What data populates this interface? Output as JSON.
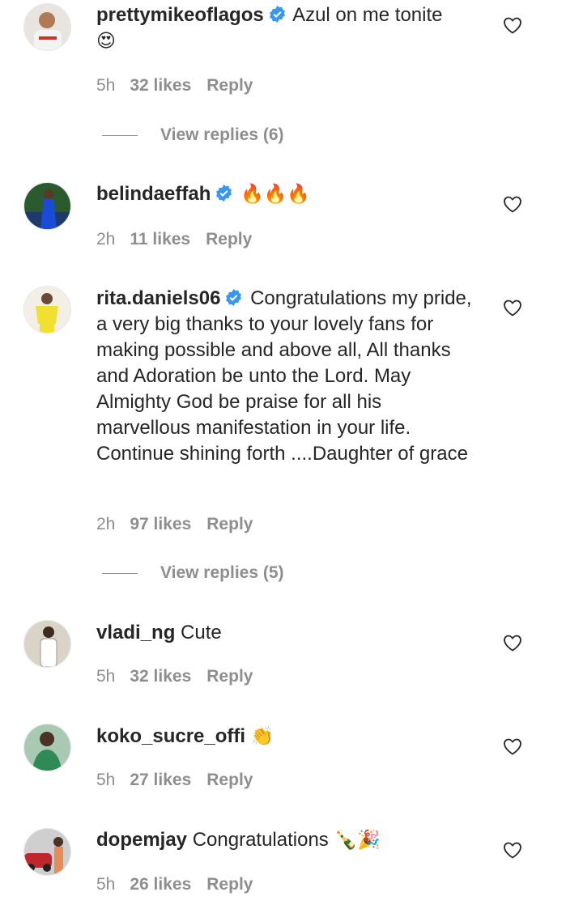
{
  "comments": [
    {
      "username": "prettymikeoflagos",
      "verified": true,
      "text": "Azul on me tonite",
      "emoji": "😍",
      "time": "5h",
      "likes": "32 likes",
      "reply": "Reply",
      "view_replies": "View replies (6)"
    },
    {
      "username": "belindaeffah",
      "verified": true,
      "text": "",
      "emoji": "🔥🔥🔥",
      "time": "2h",
      "likes": "11 likes",
      "reply": "Reply"
    },
    {
      "username": "rita.daniels06",
      "verified": true,
      "text": "Congratulations my pride, a very big thanks to your lovely fans for making possible and above all, All thanks and Adoration be unto the Lord. May Almighty God be praise for all his marvellous manifestation in your life. Continue shining forth ....Daughter of grace",
      "emoji": "",
      "time": "2h",
      "likes": "97 likes",
      "reply": "Reply",
      "view_replies": "View replies (5)"
    },
    {
      "username": "vladi_ng",
      "verified": false,
      "text": "Cute",
      "emoji": "",
      "time": "5h",
      "likes": "32 likes",
      "reply": "Reply"
    },
    {
      "username": "koko_sucre_offi",
      "verified": false,
      "text": "",
      "emoji": "👏",
      "time": "5h",
      "likes": "27 likes",
      "reply": "Reply"
    },
    {
      "username": "dopemjay",
      "verified": false,
      "text": "Congratulations",
      "emoji": "🍾🎉",
      "time": "5h",
      "likes": "26 likes",
      "reply": "Reply"
    }
  ],
  "icons": {
    "heart": "heart-outline-icon",
    "verified": "verified-badge-icon"
  },
  "colors": {
    "text": "#262626",
    "meta": "#8e8e8e",
    "verified": "#3897f0"
  }
}
